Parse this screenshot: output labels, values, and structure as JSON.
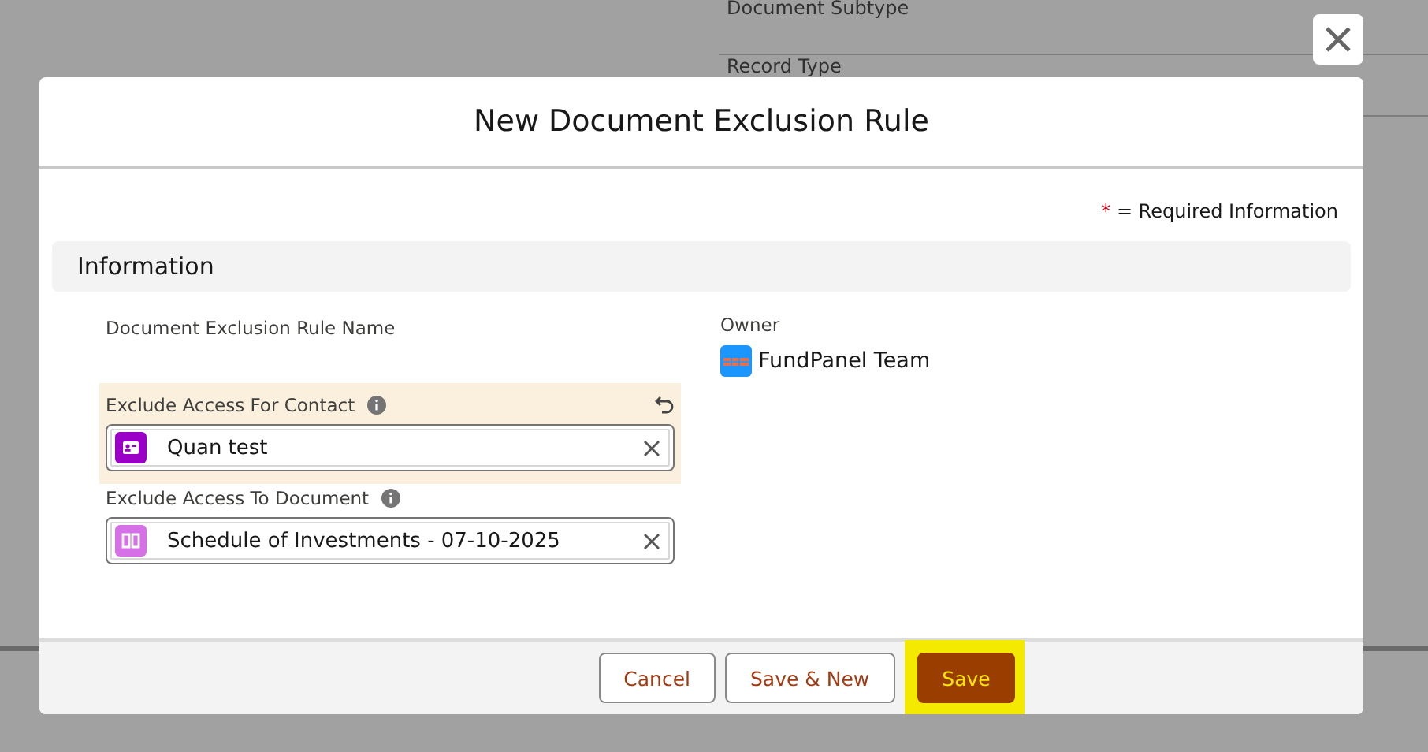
{
  "background": {
    "labels": [
      "Document Subtype",
      "Record Type"
    ]
  },
  "modal": {
    "title": "New Document Exclusion Rule",
    "required_note": {
      "mark": "*",
      "text": "= Required Information"
    },
    "section": "Information",
    "left_fields": [
      {
        "label": "Document Exclusion Rule Name",
        "kind": "text",
        "edited": false
      },
      {
        "label": "Exclude Access For Contact",
        "kind": "lookup",
        "value": "Quan test",
        "edited": true
      },
      {
        "label": "Exclude Access To Document",
        "kind": "lookup",
        "value": "Schedule of Investments - 07-10-2025",
        "edited": false
      }
    ],
    "owner": {
      "label": "Owner",
      "value": "FundPanel Team"
    },
    "buttons": [
      {
        "label": "Cancel",
        "kind": "neutral",
        "highlighted": false
      },
      {
        "label": "Save & New",
        "kind": "neutral",
        "highlighted": false
      },
      {
        "label": "Save",
        "kind": "brand",
        "highlighted": true
      }
    ]
  }
}
